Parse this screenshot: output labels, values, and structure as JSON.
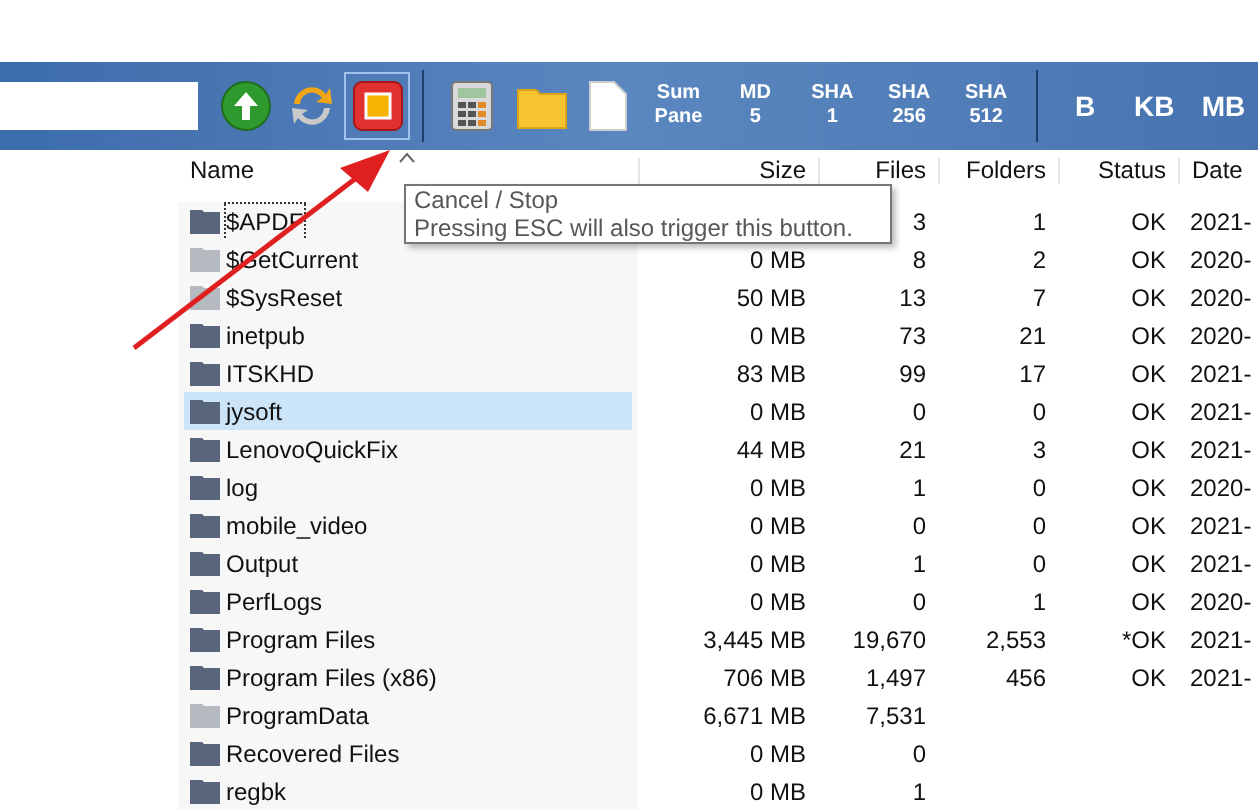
{
  "toolbar": {
    "buttons": [
      {
        "kind": "up"
      },
      {
        "kind": "refresh"
      },
      {
        "kind": "stop",
        "focused": true
      },
      {
        "kind": "separator"
      },
      {
        "kind": "calculator"
      },
      {
        "kind": "folder"
      },
      {
        "kind": "document"
      },
      {
        "kind": "text",
        "lines": [
          "Sum",
          "Pane"
        ]
      },
      {
        "kind": "text",
        "lines": [
          "MD",
          "5"
        ]
      },
      {
        "kind": "text",
        "lines": [
          "SHA",
          "1"
        ]
      },
      {
        "kind": "text",
        "lines": [
          "SHA",
          "256"
        ]
      },
      {
        "kind": "text",
        "lines": [
          "SHA",
          "512"
        ]
      },
      {
        "kind": "separator"
      },
      {
        "kind": "unit",
        "label": "B"
      },
      {
        "kind": "unit",
        "label": "KB"
      },
      {
        "kind": "unit",
        "label": "MB"
      }
    ]
  },
  "table": {
    "columns": [
      "Name",
      "Size",
      "Files",
      "Folders",
      "Status",
      "Date"
    ],
    "rows": [
      {
        "name": "$APDF",
        "size": "",
        "files": "3",
        "folders": "1",
        "status": "OK",
        "date": "2021-",
        "hidden": false,
        "selected": false,
        "focused": true
      },
      {
        "name": "$GetCurrent",
        "size": "0 MB",
        "files": "8",
        "folders": "2",
        "status": "OK",
        "date": "2020-",
        "hidden": true,
        "selected": false,
        "focused": false
      },
      {
        "name": "$SysReset",
        "size": "50 MB",
        "files": "13",
        "folders": "7",
        "status": "OK",
        "date": "2020-",
        "hidden": true,
        "selected": false,
        "focused": false
      },
      {
        "name": "inetpub",
        "size": "0 MB",
        "files": "73",
        "folders": "21",
        "status": "OK",
        "date": "2020-",
        "hidden": false,
        "selected": false,
        "focused": false
      },
      {
        "name": "ITSKHD",
        "size": "83 MB",
        "files": "99",
        "folders": "17",
        "status": "OK",
        "date": "2021-",
        "hidden": false,
        "selected": false,
        "focused": false
      },
      {
        "name": "jysoft",
        "size": "0 MB",
        "files": "0",
        "folders": "0",
        "status": "OK",
        "date": "2021-",
        "hidden": false,
        "selected": true,
        "focused": false
      },
      {
        "name": "LenovoQuickFix",
        "size": "44 MB",
        "files": "21",
        "folders": "3",
        "status": "OK",
        "date": "2021-",
        "hidden": false,
        "selected": false,
        "focused": false
      },
      {
        "name": "log",
        "size": "0 MB",
        "files": "1",
        "folders": "0",
        "status": "OK",
        "date": "2020-",
        "hidden": false,
        "selected": false,
        "focused": false
      },
      {
        "name": "mobile_video",
        "size": "0 MB",
        "files": "0",
        "folders": "0",
        "status": "OK",
        "date": "2021-",
        "hidden": false,
        "selected": false,
        "focused": false
      },
      {
        "name": "Output",
        "size": "0 MB",
        "files": "1",
        "folders": "0",
        "status": "OK",
        "date": "2021-",
        "hidden": false,
        "selected": false,
        "focused": false
      },
      {
        "name": "PerfLogs",
        "size": "0 MB",
        "files": "0",
        "folders": "1",
        "status": "OK",
        "date": "2020-",
        "hidden": false,
        "selected": false,
        "focused": false
      },
      {
        "name": "Program Files",
        "size": "3,445 MB",
        "files": "19,670",
        "folders": "2,553",
        "status": "*OK",
        "date": "2021-",
        "hidden": false,
        "selected": false,
        "focused": false
      },
      {
        "name": "Program Files (x86)",
        "size": "706 MB",
        "files": "1,497",
        "folders": "456",
        "status": "OK",
        "date": "2021-",
        "hidden": false,
        "selected": false,
        "focused": false
      },
      {
        "name": "ProgramData",
        "size": "6,671 MB",
        "files": "7,531",
        "folders": "",
        "status": "",
        "date": "",
        "hidden": true,
        "selected": false,
        "focused": false
      },
      {
        "name": "Recovered Files",
        "size": "0 MB",
        "files": "0",
        "folders": "",
        "status": "",
        "date": "",
        "hidden": false,
        "selected": false,
        "focused": false
      },
      {
        "name": "regbk",
        "size": "0 MB",
        "files": "1",
        "folders": "",
        "status": "",
        "date": "",
        "hidden": false,
        "selected": false,
        "focused": false
      }
    ]
  },
  "tooltip": {
    "title": "Cancel / Stop",
    "text": "Pressing ESC will also trigger this button."
  }
}
